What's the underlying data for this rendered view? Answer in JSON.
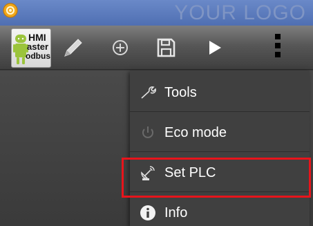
{
  "status_bar": {
    "logo_text": "YOUR LOGO"
  },
  "toolbar": {
    "app_icon": {
      "line1": "HMI",
      "line2": "aster",
      "line3": "odbus"
    },
    "buttons": [
      "pencil-icon",
      "add-circle-icon",
      "save-icon",
      "play-icon",
      "overflow-menu-icon"
    ]
  },
  "menu": {
    "items": [
      {
        "label": "Tools",
        "icon": "wrench-icon"
      },
      {
        "label": "Eco mode",
        "icon": "power-icon"
      },
      {
        "label": "Set PLC",
        "icon": "satellite-dish-icon"
      },
      {
        "label": "Info",
        "icon": "info-icon"
      }
    ]
  },
  "colors": {
    "status_bar": "#5a79bd",
    "highlight": "#e8141b",
    "menu_bg": "#404040"
  }
}
